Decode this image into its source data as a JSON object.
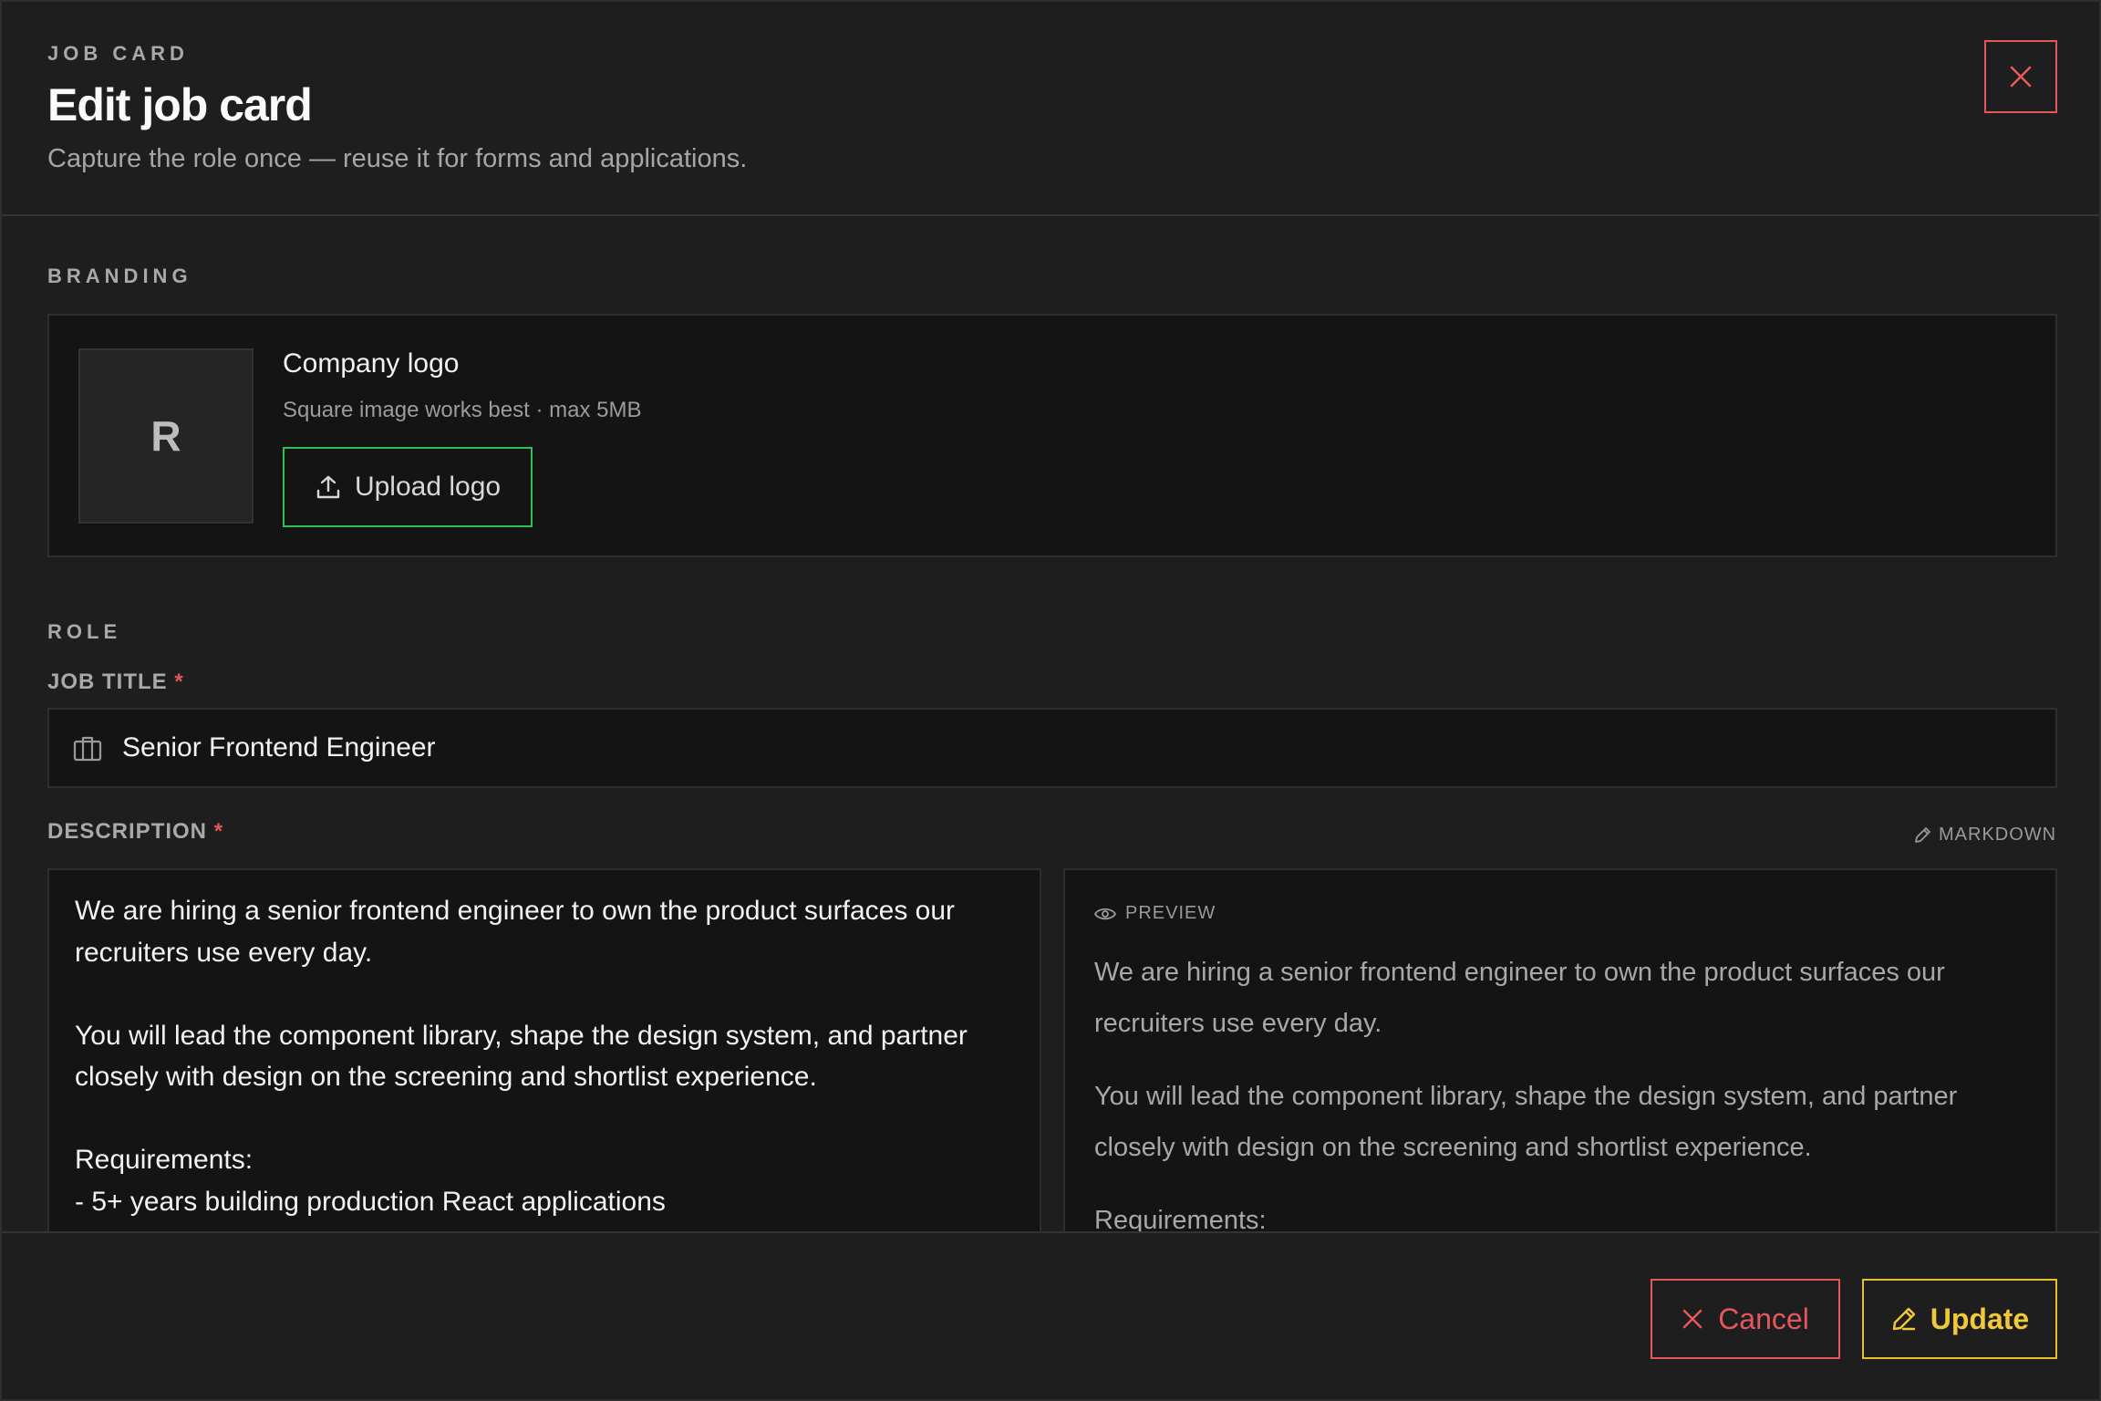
{
  "header": {
    "eyebrow": "JOB CARD",
    "title": "Edit job card",
    "subtitle": "Capture the role once — reuse it for forms and applications.",
    "close_icon": "close-icon"
  },
  "branding": {
    "section_label": "BRANDING",
    "logo_initial": "R",
    "logo_title": "Company logo",
    "logo_hint": "Square image works best · max 5MB",
    "upload_label": "Upload logo",
    "upload_icon": "upload-icon"
  },
  "role": {
    "section_label": "ROLE",
    "job_title_label": "JOB TITLE",
    "job_title_value": "Senior Frontend Engineer",
    "job_title_icon": "briefcase-icon",
    "description_label": "DESCRIPTION",
    "required_mark": "*",
    "markdown_tag": "MARKDOWN",
    "description_value": "We are hiring a senior frontend engineer to own the product surfaces our recruiters use every day.\n\nYou will lead the component library, shape the design system, and partner closely with design on the screening and shortlist experience.\n\nRequirements:\n- 5+ years building production React applications\n- Strong TypeScript and testing experience",
    "preview_label": "PREVIEW",
    "preview_paragraphs": [
      "We are hiring a senior frontend engineer to own the product surfaces our recruiters use every day.",
      "You will lead the component library, shape the design system, and partner closely with design on the screening and shortlist experience.",
      "Requirements:"
    ]
  },
  "footer": {
    "cancel_label": "Cancel",
    "update_label": "Update"
  },
  "colors": {
    "danger": "#e4575a",
    "success": "#2fbf5a",
    "warning": "#e6c12a"
  }
}
